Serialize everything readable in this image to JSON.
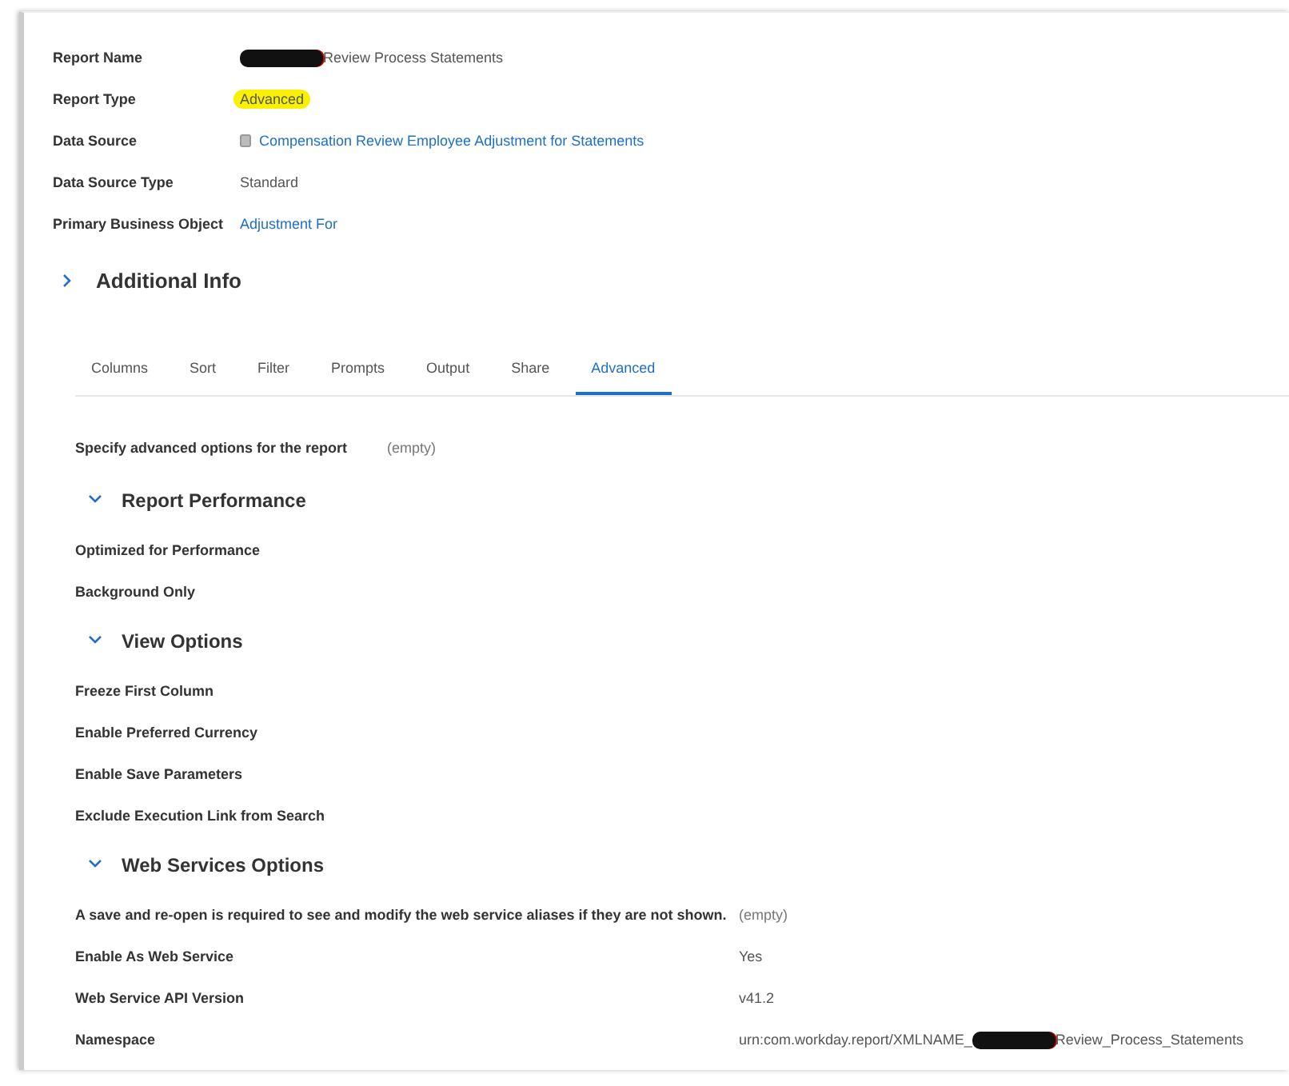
{
  "summary": [
    {
      "label": "Report Name",
      "value": "Review Process Statements",
      "kind": "redacted"
    },
    {
      "label": "Report Type",
      "value": "Advanced",
      "kind": "highlighted"
    },
    {
      "label": "Data Source",
      "value": "Compensation Review Employee Adjustment for Statements",
      "kind": "link_icon"
    },
    {
      "label": "Data Source Type",
      "value": "Standard",
      "kind": "plain"
    },
    {
      "label": "Primary Business Object",
      "value": "Adjustment For",
      "kind": "link"
    }
  ],
  "additional_info": {
    "title": "Additional Info",
    "expanded": false
  },
  "tabs": [
    {
      "label": "Columns",
      "selected": false
    },
    {
      "label": "Sort",
      "selected": false
    },
    {
      "label": "Filter",
      "selected": false
    },
    {
      "label": "Prompts",
      "selected": false
    },
    {
      "label": "Output",
      "selected": false
    },
    {
      "label": "Share",
      "selected": false
    },
    {
      "label": "Advanced",
      "selected": true
    }
  ],
  "description": {
    "label": "Specify advanced options for the report",
    "value": "(empty)"
  },
  "sections": [
    {
      "title": "Report Performance",
      "expanded": true,
      "rows": [
        {
          "label": "Optimized for Performance"
        },
        {
          "label": "Background Only"
        }
      ]
    },
    {
      "title": "View Options",
      "expanded": true,
      "rows": [
        {
          "label": "Freeze First Column"
        },
        {
          "label": "Enable Preferred Currency"
        },
        {
          "label": "Enable Save Parameters"
        },
        {
          "label": "Exclude Execution Link from Search"
        }
      ]
    },
    {
      "title": "Web Services Options",
      "expanded": true,
      "rows": [
        {
          "label": "A save and re-open is required to see and modify the web service aliases if they are not shown.",
          "value": "(empty)",
          "kind": "muted"
        },
        {
          "label": "Enable As Web Service",
          "value": "Yes",
          "kind": "plain"
        },
        {
          "label": "Web Service API Version",
          "value": "v41.2",
          "kind": "plain"
        },
        {
          "label": "Namespace",
          "prefix": "urn:com.workday.report/XMLNAME_",
          "value": "Review_Process_Statements",
          "kind": "redacted"
        }
      ]
    }
  ]
}
